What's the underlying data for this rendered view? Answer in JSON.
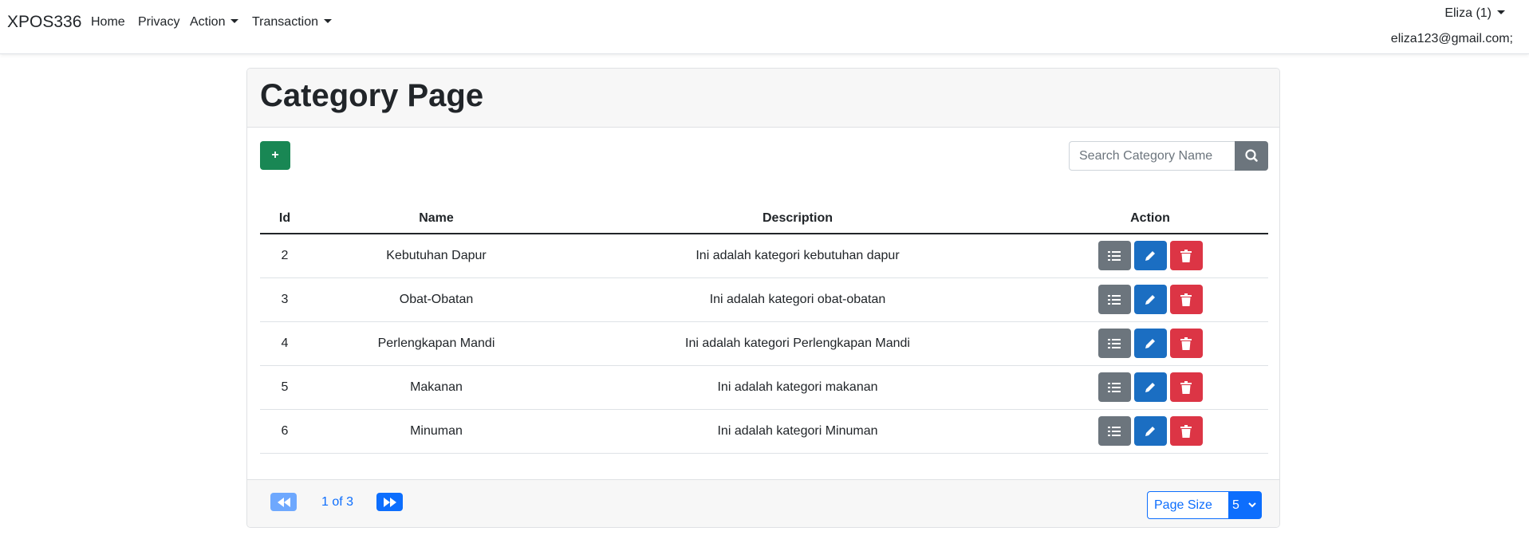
{
  "navbar": {
    "brand": "XPOS336",
    "links": [
      "Home",
      "Privacy",
      "Action",
      "Transaction"
    ],
    "user_name": "Eliza (1)",
    "user_email": "eliza123@gmail.com;"
  },
  "page": {
    "title": "Category Page",
    "add_label": "+",
    "search_placeholder": "Search Category Name"
  },
  "table": {
    "headers": [
      "Id",
      "Name",
      "Description",
      "Action"
    ],
    "rows": [
      {
        "id": "2",
        "name": "Kebutuhan Dapur",
        "description": "Ini adalah kategori kebutuhan dapur"
      },
      {
        "id": "3",
        "name": "Obat-Obatan",
        "description": "Ini adalah kategori obat-obatan"
      },
      {
        "id": "4",
        "name": "Perlengkapan Mandi",
        "description": "Ini adalah kategori Perlengkapan Mandi"
      },
      {
        "id": "5",
        "name": "Makanan",
        "description": "Ini adalah kategori makanan"
      },
      {
        "id": "6",
        "name": "Minuman",
        "description": "Ini adalah kategori Minuman"
      }
    ],
    "action_icons": [
      "list-icon",
      "pencil-icon",
      "trash-icon"
    ]
  },
  "pagination": {
    "info": "1 of 3",
    "page_size_label": "Page Size",
    "page_size_value": "5"
  },
  "colors": {
    "success": "#198754",
    "secondary": "#6c757d",
    "primary": "#1b6ec2",
    "danger": "#dc3545",
    "link": "#0d6efd"
  }
}
